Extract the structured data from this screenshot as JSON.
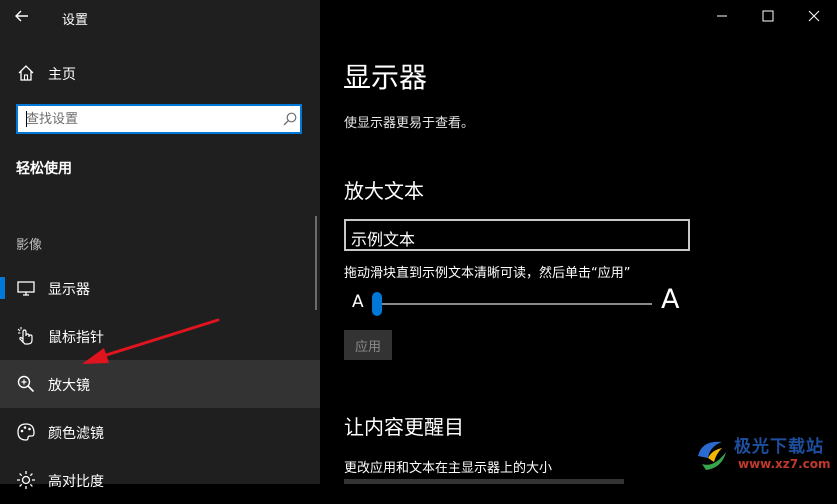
{
  "window": {
    "title": "设置",
    "controls": {
      "minimize": "minimize-icon",
      "maximize": "maximize-icon",
      "close": "close-icon"
    }
  },
  "sidebar": {
    "home_label": "主页",
    "search": {
      "placeholder": "查找设置",
      "value": ""
    },
    "section_title": "轻松使用",
    "group_label": "影像",
    "items": [
      {
        "label": "显示器",
        "icon": "monitor-icon",
        "selected": true
      },
      {
        "label": "鼠标指针",
        "icon": "mouse-pointer-icon",
        "selected": false
      },
      {
        "label": "放大镜",
        "icon": "magnifier-icon",
        "selected": false,
        "hover": true
      },
      {
        "label": "颜色滤镜",
        "icon": "color-filter-icon",
        "selected": false
      },
      {
        "label": "高对比度",
        "icon": "contrast-icon",
        "selected": false
      }
    ]
  },
  "main": {
    "title": "显示器",
    "description": "使显示器更易于查看。",
    "enlarge_text": {
      "heading": "放大文本",
      "sample_text": "示例文本",
      "hint": "拖动滑块直到示例文本清晰可读，然后单击“应用”",
      "small_a": "A",
      "large_a": "A",
      "slider_percent": 0,
      "apply_label": "应用"
    },
    "make_everything_bigger": {
      "heading": "让内容更醒目",
      "description": "更改应用和文本在主显示器上的大小"
    }
  },
  "watermark": {
    "brand": "极光下载站",
    "url": "www.xz7.com"
  },
  "colors": {
    "sidebar_bg": "#1f1f1f",
    "main_bg": "#000000",
    "accent": "#0078d7",
    "annotation_arrow": "#e0141e"
  }
}
